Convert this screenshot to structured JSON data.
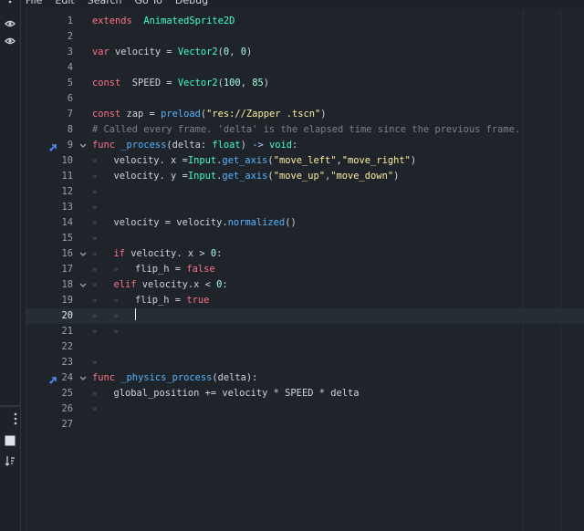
{
  "menubar": [
    "File",
    "Edit",
    "Search",
    "Go To",
    "Debug"
  ],
  "left_panel": {
    "top_icons": [
      "kebab-menu-icon",
      "eye-icon",
      "eye-icon"
    ],
    "bottom_icons": [
      "kebab-menu-icon",
      "square-icon",
      "sort-icon"
    ]
  },
  "colors": {
    "background": "#1d2229",
    "keyword": "#ff7085",
    "type": "#42ffc2",
    "number": "#a1ffe0",
    "string": "#ffeda1",
    "function": "#57b3ff",
    "comment": "#7b818a",
    "override_icon": "#4f8df7"
  },
  "editor": {
    "current_line": 20,
    "lines": [
      {
        "n": "1",
        "indent": 0,
        "tokens": [
          [
            "kw",
            "extends"
          ],
          [
            "",
            "  "
          ],
          [
            "ty",
            "AnimatedSprite2D"
          ]
        ]
      },
      {
        "n": "2",
        "indent": 0,
        "tokens": []
      },
      {
        "n": "3",
        "indent": 0,
        "tokens": [
          [
            "kw",
            "var"
          ],
          [
            "",
            " velocity = "
          ],
          [
            "ty",
            "Vector2"
          ],
          [
            "",
            "("
          ],
          [
            "num",
            "0"
          ],
          [
            "",
            ", "
          ],
          [
            "num",
            "0"
          ],
          [
            "",
            ")"
          ]
        ]
      },
      {
        "n": "4",
        "indent": 0,
        "tokens": []
      },
      {
        "n": "5",
        "indent": 0,
        "tokens": [
          [
            "kw",
            "const"
          ],
          [
            "",
            "  SPEED = "
          ],
          [
            "ty",
            "Vector2"
          ],
          [
            "",
            "("
          ],
          [
            "num",
            "100"
          ],
          [
            "",
            ", "
          ],
          [
            "num",
            "85"
          ],
          [
            "",
            ")"
          ]
        ]
      },
      {
        "n": "6",
        "indent": 0,
        "tokens": []
      },
      {
        "n": "7",
        "indent": 0,
        "tokens": [
          [
            "kw",
            "const"
          ],
          [
            "",
            " zap = "
          ],
          [
            "fn",
            "preload"
          ],
          [
            "",
            "("
          ],
          [
            "str",
            "\"res://Zapper .tscn\""
          ],
          [
            "",
            ")"
          ]
        ]
      },
      {
        "n": "8",
        "indent": 0,
        "tokens": [
          [
            "cm",
            "# Called every frame. 'delta' is the elapsed time since the previous frame."
          ]
        ]
      },
      {
        "n": "9",
        "indent": 0,
        "override": true,
        "fold": true,
        "tokens": [
          [
            "kw",
            "func"
          ],
          [
            "",
            " "
          ],
          [
            "fn",
            "_process"
          ],
          [
            "",
            "(delta: "
          ],
          [
            "ty",
            "float"
          ],
          [
            "",
            ") "
          ],
          [
            "sym",
            "->"
          ],
          [
            "",
            " "
          ],
          [
            "ty",
            "void"
          ],
          [
            "",
            ":"
          ]
        ]
      },
      {
        "n": "10",
        "indent": 1,
        "tokens": [
          [
            "",
            "velocity. x ="
          ],
          [
            "ty",
            "Input"
          ],
          [
            "",
            "."
          ],
          [
            "fn",
            "get_axis"
          ],
          [
            "",
            "("
          ],
          [
            "str",
            "\"move_left\""
          ],
          [
            "",
            ","
          ],
          [
            "str",
            "\"move_right\""
          ],
          [
            "",
            ")"
          ]
        ]
      },
      {
        "n": "11",
        "indent": 1,
        "tokens": [
          [
            "",
            "velocity. y ="
          ],
          [
            "ty",
            "Input"
          ],
          [
            "",
            "."
          ],
          [
            "fn",
            "get_axis"
          ],
          [
            "",
            "("
          ],
          [
            "str",
            "\"move_up\""
          ],
          [
            "",
            ","
          ],
          [
            "str",
            "\"move_down\""
          ],
          [
            "",
            ")"
          ]
        ]
      },
      {
        "n": "12",
        "indent": 1,
        "tokens": []
      },
      {
        "n": "13",
        "indent": 1,
        "tokens": []
      },
      {
        "n": "14",
        "indent": 1,
        "tokens": [
          [
            "",
            "velocity = velocity."
          ],
          [
            "fn",
            "normalized"
          ],
          [
            "",
            "()"
          ]
        ]
      },
      {
        "n": "15",
        "indent": 1,
        "tokens": []
      },
      {
        "n": "16",
        "indent": 1,
        "fold": true,
        "tokens": [
          [
            "kw",
            "if"
          ],
          [
            "",
            " velocity. x > "
          ],
          [
            "num",
            "0"
          ],
          [
            "",
            ":"
          ]
        ]
      },
      {
        "n": "17",
        "indent": 2,
        "tokens": [
          [
            "",
            "flip_h = "
          ],
          [
            "kw",
            "false"
          ]
        ]
      },
      {
        "n": "18",
        "indent": 1,
        "fold": true,
        "tokens": [
          [
            "kw",
            "elif"
          ],
          [
            "",
            " velocity.x < "
          ],
          [
            "num",
            "0"
          ],
          [
            "",
            ":"
          ]
        ]
      },
      {
        "n": "19",
        "indent": 2,
        "tokens": [
          [
            "",
            "flip_h = "
          ],
          [
            "kw",
            "true"
          ]
        ]
      },
      {
        "n": "20",
        "indent": 2,
        "caret": true,
        "tokens": []
      },
      {
        "n": "21",
        "indent": 2,
        "tokens": []
      },
      {
        "n": "22",
        "indent": 0,
        "tokens": []
      },
      {
        "n": "23",
        "indent": 1,
        "tokens": []
      },
      {
        "n": "24",
        "indent": 0,
        "override": true,
        "fold": true,
        "tokens": [
          [
            "kw",
            "func"
          ],
          [
            "",
            " "
          ],
          [
            "fn",
            "_physics_process"
          ],
          [
            "",
            "(delta):"
          ]
        ]
      },
      {
        "n": "25",
        "indent": 1,
        "tokens": [
          [
            "",
            "global_position += velocity * SPEED * delta"
          ]
        ]
      },
      {
        "n": "26",
        "indent": 1,
        "tokens": []
      },
      {
        "n": "27",
        "indent": 0,
        "tokens": []
      }
    ]
  }
}
